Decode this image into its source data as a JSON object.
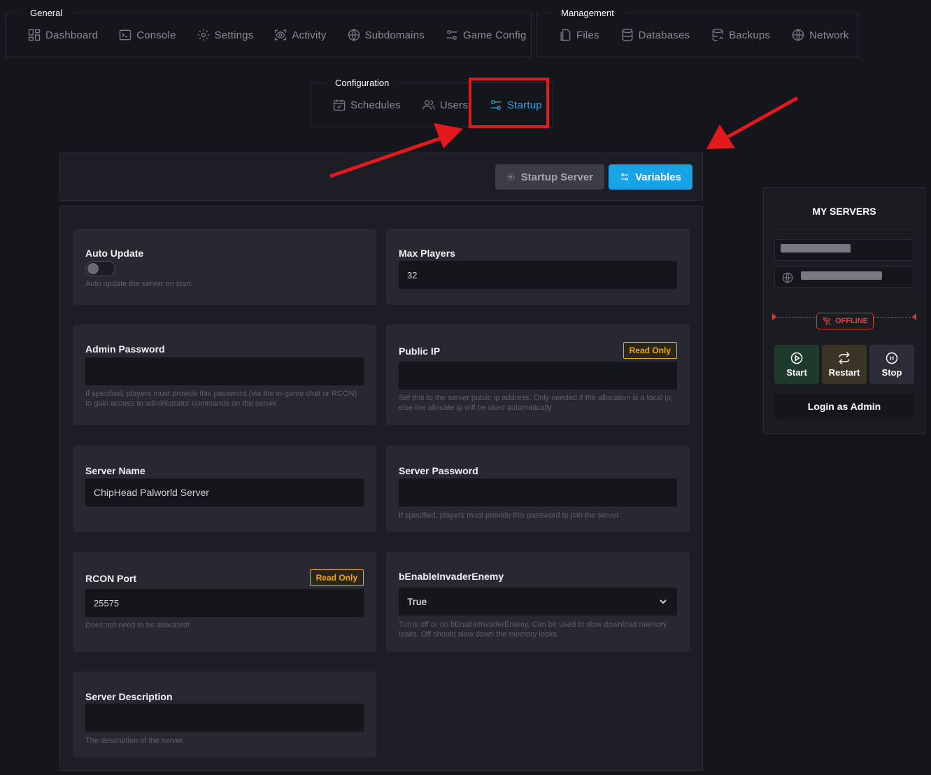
{
  "nav_general": {
    "legend": "General",
    "items": [
      "Dashboard",
      "Console",
      "Settings",
      "Activity",
      "Subdomains",
      "Game Config"
    ]
  },
  "nav_management": {
    "legend": "Management",
    "items": [
      "Files",
      "Databases",
      "Backups",
      "Network"
    ]
  },
  "nav_configuration": {
    "legend": "Configuration",
    "items": [
      "Schedules",
      "Users",
      "Startup"
    ],
    "active": "Startup"
  },
  "tabs": {
    "startup_server": "Startup Server",
    "variables": "Variables"
  },
  "variables": {
    "auto_update": {
      "label": "Auto Update",
      "help": "Auto update the server on start."
    },
    "max_players": {
      "label": "Max Players",
      "value": "32"
    },
    "admin_password": {
      "label": "Admin Password",
      "value": "",
      "help": "If specified, players must provide this password (via the in-game chat or RCON) to gain access to administrator commands on the server."
    },
    "public_ip": {
      "label": "Public IP",
      "badge": "Read Only",
      "value": "",
      "help": "Set this to the server public ip address. Only needed if the allocation is a local ip, else the allocate ip will be used automatically"
    },
    "server_name": {
      "label": "Server Name",
      "value": "ChipHead Palworld Server"
    },
    "server_password": {
      "label": "Server Password",
      "value": "",
      "help": "If specified, players must provide this password to join the server."
    },
    "rcon_port": {
      "label": "RCON Port",
      "badge": "Read Only",
      "value": "25575",
      "help": "Does not need to be allocated!"
    },
    "invader": {
      "label": "bEnableInvaderEnemy",
      "value": "True",
      "help": "Turns off or on bEnableInvaderEnemy, Can be used to slow download memory leaks. Off should slow down the memory leaks."
    },
    "description": {
      "label": "Server Description",
      "value": "",
      "help": "The description of the server."
    }
  },
  "servers": {
    "title": "MY SERVERS",
    "status": "OFFLINE",
    "start": "Start",
    "restart": "Restart",
    "stop": "Stop",
    "login": "Login as Admin"
  },
  "colors": {
    "accent": "#18a3e6",
    "highlight": "#e3191d",
    "read_only": "#f0a818",
    "offline": "#e04646"
  }
}
